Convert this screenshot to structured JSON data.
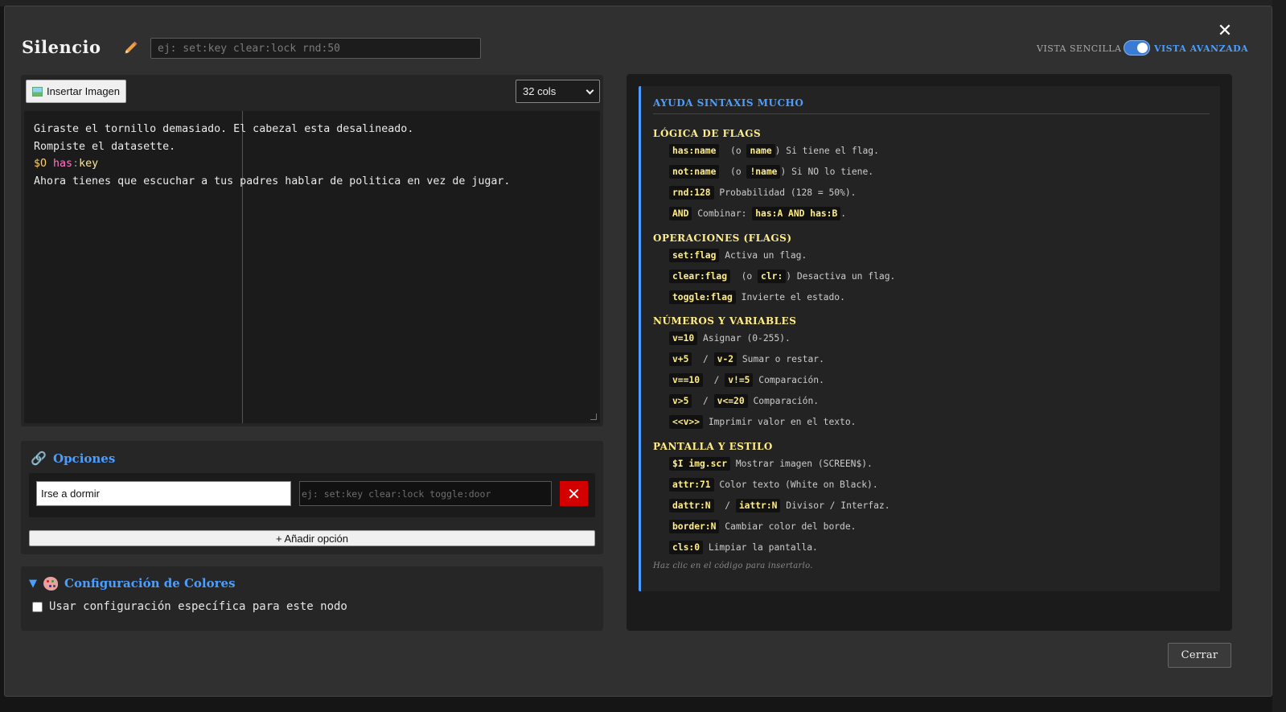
{
  "modal": {
    "title": "Silencio",
    "condition_placeholder": "ej: set:key clear:lock rnd:50",
    "view_simple_label": "VISTA SENCILLA",
    "view_advanced_label": "VISTA AVANZADA",
    "view_mode": "advanced",
    "close_label": "Cerrar"
  },
  "editor": {
    "insert_image_label": "Insertar Imagen",
    "cols_selected": "32 cols",
    "lines": [
      "Giraste el tornillo demasiado. El cabezal esta desalineado.",
      "Rompiste el datasette.",
      "",
      "Ahora tienes que escuchar a tus padres hablar de politica en vez de jugar."
    ],
    "command_line": {
      "var": "$O",
      "keyword": "has",
      "colon": ":",
      "value": "key"
    }
  },
  "options": {
    "title": "Opciones",
    "items": [
      {
        "text": "Irse a dormir",
        "condition_placeholder": "ej: set:key clear:lock toggle:door"
      }
    ],
    "delete_label": "✕",
    "add_label": "+ Añadir opción"
  },
  "colors": {
    "title": "Configuración de Colores",
    "checkbox_label": "Usar configuración específica para este nodo",
    "checked": false
  },
  "help": {
    "title": "AYUDA SINTAXIS MUCHO",
    "sections": {
      "flags_logic": {
        "title": "LÓGICA DE FLAGS",
        "l1": {
          "c1": "has:name",
          "t1": "(o",
          "c2": "name",
          "t2": ") Si tiene el flag."
        },
        "l2": {
          "c1": "not:name",
          "t1": "(o",
          "c2": "!name",
          "t2": ") Si NO lo tiene."
        },
        "l3": {
          "c1": "rnd:128",
          "t1": "Probabilidad (128 = 50%)."
        },
        "l4": {
          "c1": "AND",
          "t1": "Combinar:",
          "c2": "has:A AND has:B",
          "t2": "."
        }
      },
      "flag_ops": {
        "title": "OPERACIONES (FLAGS)",
        "l1": {
          "c1": "set:flag",
          "t1": "Activa un flag."
        },
        "l2": {
          "c1": "clear:flag",
          "t1": "(o",
          "c2": "clr:",
          "t2": ") Desactiva un flag."
        },
        "l3": {
          "c1": "toggle:flag",
          "t1": "Invierte el estado."
        }
      },
      "numbers": {
        "title": "NÚMEROS Y VARIABLES",
        "l1": {
          "c1": "v=10",
          "t1": "Asignar (0-255)."
        },
        "l2": {
          "c1": "v+5",
          "t1": "/",
          "c2": "v-2",
          "t2": "Sumar o restar."
        },
        "l3": {
          "c1": "v==10",
          "t1": "/",
          "c2": "v!=5",
          "t2": "Comparación."
        },
        "l4": {
          "c1": "v>5",
          "t1": "/",
          "c2": "v<=20",
          "t2": "Comparación."
        },
        "l5": {
          "c1": "<<v>>",
          "t1": "Imprimir valor en el texto."
        }
      },
      "screen": {
        "title": "PANTALLA Y ESTILO",
        "l1": {
          "c1": "$I img.scr",
          "t1": "Mostrar imagen (SCREEN$)."
        },
        "l2": {
          "c1": "attr:71",
          "t1": "Color texto (White on Black)."
        },
        "l3": {
          "c1": "dattr:N",
          "t1": "/",
          "c2": "iattr:N",
          "t2": "Divisor / Interfaz."
        },
        "l4": {
          "c1": "border:N",
          "t1": "Cambiar color del borde."
        },
        "l5": {
          "c1": "cls:0",
          "t1": "Limpiar la pantalla."
        }
      }
    },
    "footer": "Haz clic en el código para insertarlo."
  },
  "colors_theme": {
    "accent": "#4a9eff",
    "help_heading": "#ffee88",
    "delete_red": "#d40000"
  }
}
